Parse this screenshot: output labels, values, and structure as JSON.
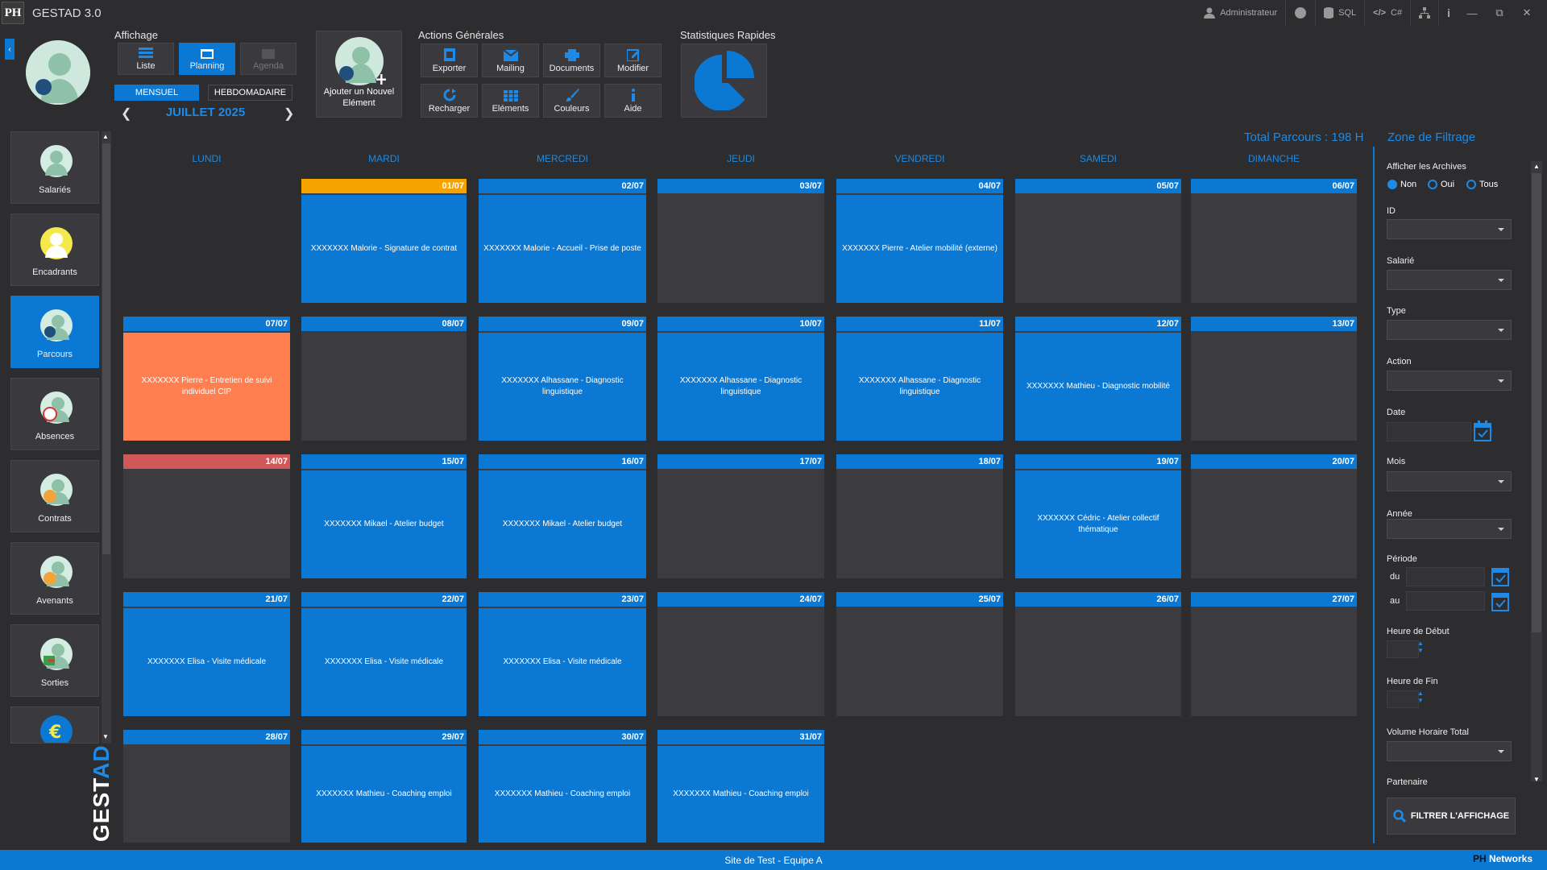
{
  "app": {
    "logo": "PH",
    "title": "GESTAD 3.0"
  },
  "titlebar": {
    "user": "Administrateur",
    "sql": "SQL",
    "code": "C#"
  },
  "affichage": {
    "label": "Affichage",
    "buttons": [
      "Liste",
      "Planning",
      "Agenda"
    ],
    "modes": [
      "MENSUEL",
      "HEBDOMADAIRE"
    ],
    "month": "JUILLET 2025"
  },
  "add": {
    "label": "Ajouter un Nouvel Elément"
  },
  "actions": {
    "label": "Actions Générales",
    "buttons": [
      "Exporter",
      "Mailing",
      "Documents",
      "Modifier",
      "Recharger",
      "Eléments",
      "Couleurs",
      "Aide"
    ]
  },
  "stats": {
    "label": "Statistiques Rapides"
  },
  "sidebar": {
    "items": [
      "Salariés",
      "Encadrants",
      "Parcours",
      "Absences",
      "Contrats",
      "Avenants",
      "Sorties"
    ]
  },
  "brand": {
    "text1": "GEST",
    "text2": "AD"
  },
  "calendar": {
    "total": "Total Parcours : 198 H",
    "days": [
      "LUNDI",
      "MARDI",
      "MERCREDI",
      "JEUDI",
      "VENDREDI",
      "SAMEDI",
      "DIMANCHE"
    ],
    "weeks": [
      [
        {
          "d": ""
        },
        {
          "d": "01/07",
          "e": "XXXXXXX Malorie - Signature de contrat",
          "today": true
        },
        {
          "d": "02/07",
          "e": "XXXXXXX Malorie - Accueil - Prise de poste"
        },
        {
          "d": "03/07"
        },
        {
          "d": "04/07",
          "e": "XXXXXXX Pierre - Atelier mobilité (externe)"
        },
        {
          "d": "05/07"
        },
        {
          "d": "06/07"
        }
      ],
      [
        {
          "d": "07/07",
          "e": "XXXXXXX Pierre - Entretien de suivi individuel CIP",
          "orange": true
        },
        {
          "d": "08/07"
        },
        {
          "d": "09/07",
          "e": "XXXXXXX Alhassane - Diagnostic linguistique"
        },
        {
          "d": "10/07",
          "e": "XXXXXXX Alhassane - Diagnostic linguistique"
        },
        {
          "d": "11/07",
          "e": "XXXXXXX Alhassane - Diagnostic linguistique"
        },
        {
          "d": "12/07",
          "e": "XXXXXXX Mathieu - Diagnostic mobilité"
        },
        {
          "d": "13/07"
        }
      ],
      [
        {
          "d": "14/07",
          "holiday": true
        },
        {
          "d": "15/07",
          "e": "XXXXXXX Mikael - Atelier budget"
        },
        {
          "d": "16/07",
          "e": "XXXXXXX Mikael - Atelier budget"
        },
        {
          "d": "17/07"
        },
        {
          "d": "18/07"
        },
        {
          "d": "19/07",
          "e": "XXXXXXX Cédric - Atelier collectif thématique"
        },
        {
          "d": "20/07"
        }
      ],
      [
        {
          "d": "21/07",
          "e": "XXXXXXX Elisa - Visite médicale"
        },
        {
          "d": "22/07",
          "e": "XXXXXXX Elisa - Visite médicale"
        },
        {
          "d": "23/07",
          "e": "XXXXXXX Elisa - Visite médicale"
        },
        {
          "d": "24/07"
        },
        {
          "d": "25/07"
        },
        {
          "d": "26/07"
        },
        {
          "d": "27/07"
        }
      ],
      [
        {
          "d": "28/07"
        },
        {
          "d": "29/07",
          "e": "XXXXXXX Mathieu - Coaching emploi"
        },
        {
          "d": "30/07",
          "e": "XXXXXXX Mathieu - Coaching emploi"
        },
        {
          "d": "31/07",
          "e": "XXXXXXX Mathieu - Coaching emploi"
        }
      ]
    ]
  },
  "filter": {
    "title": "Zone de Filtrage",
    "archives": "Afficher les Archives",
    "radio": [
      "Non",
      "Oui",
      "Tous"
    ],
    "fields": {
      "id": "ID",
      "salarie": "Salarié",
      "type": "Type",
      "action": "Action",
      "date": "Date",
      "mois": "Mois",
      "annee": "Année",
      "periode": "Période",
      "du": "du",
      "au": "au",
      "hdebut": "Heure de Début",
      "hfin": "Heure de Fin",
      "volume": "Volume Horaire Total",
      "partenaire": "Partenaire"
    },
    "button": "FILTRER L'AFFICHAGE"
  },
  "status": {
    "text": "Site de Test - Equipe A",
    "brand_ph": "PH",
    "brand_net": "Networks"
  }
}
